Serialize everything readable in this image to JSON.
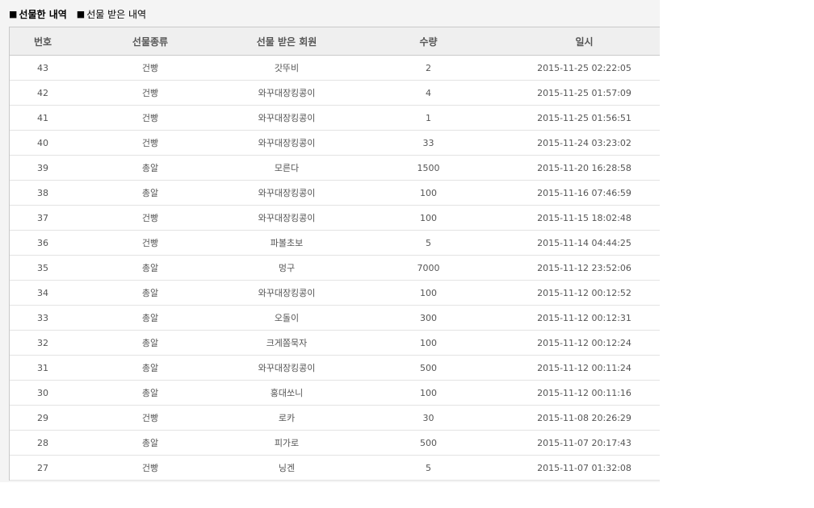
{
  "tabs": [
    {
      "marker": "■",
      "label": "선물한 내역"
    },
    {
      "marker": "■",
      "label": "선물 받은 내역"
    }
  ],
  "table": {
    "headers": [
      "번호",
      "선물종류",
      "선물 받은 회원",
      "수량",
      "일시"
    ],
    "rows": [
      {
        "num": "43",
        "type": "건빵",
        "member": "갓뚜비",
        "qty": "2",
        "date": "2015-11-25 02:22:05"
      },
      {
        "num": "42",
        "type": "건빵",
        "member": "와꾸대장킹콩이",
        "qty": "4",
        "date": "2015-11-25 01:57:09"
      },
      {
        "num": "41",
        "type": "건빵",
        "member": "와꾸대장킹콩이",
        "qty": "1",
        "date": "2015-11-25 01:56:51"
      },
      {
        "num": "40",
        "type": "건빵",
        "member": "와꾸대장킹콩이",
        "qty": "33",
        "date": "2015-11-24 03:23:02"
      },
      {
        "num": "39",
        "type": "총알",
        "member": "모른다",
        "qty": "1500",
        "date": "2015-11-20 16:28:58"
      },
      {
        "num": "38",
        "type": "총알",
        "member": "와꾸대장킹콩이",
        "qty": "100",
        "date": "2015-11-16 07:46:59"
      },
      {
        "num": "37",
        "type": "건빵",
        "member": "와꾸대장킹콩이",
        "qty": "100",
        "date": "2015-11-15 18:02:48"
      },
      {
        "num": "36",
        "type": "건빵",
        "member": "파볼초보",
        "qty": "5",
        "date": "2015-11-14 04:44:25"
      },
      {
        "num": "35",
        "type": "총알",
        "member": "멍구",
        "qty": "7000",
        "date": "2015-11-12 23:52:06"
      },
      {
        "num": "34",
        "type": "총알",
        "member": "와꾸대장킹콩이",
        "qty": "100",
        "date": "2015-11-12 00:12:52"
      },
      {
        "num": "33",
        "type": "총알",
        "member": "오돌이",
        "qty": "300",
        "date": "2015-11-12 00:12:31"
      },
      {
        "num": "32",
        "type": "총알",
        "member": "크게쫌묵자",
        "qty": "100",
        "date": "2015-11-12 00:12:24"
      },
      {
        "num": "31",
        "type": "총알",
        "member": "와꾸대장킹콩이",
        "qty": "500",
        "date": "2015-11-12 00:11:24"
      },
      {
        "num": "30",
        "type": "총알",
        "member": "홍대쏘니",
        "qty": "100",
        "date": "2015-11-12 00:11:16"
      },
      {
        "num": "29",
        "type": "건빵",
        "member": "로카",
        "qty": "30",
        "date": "2015-11-08 20:26:29"
      },
      {
        "num": "28",
        "type": "총알",
        "member": "피가로",
        "qty": "500",
        "date": "2015-11-07 20:17:43"
      },
      {
        "num": "27",
        "type": "건빵",
        "member": "닝겐",
        "qty": "5",
        "date": "2015-11-07 01:32:08"
      }
    ]
  }
}
